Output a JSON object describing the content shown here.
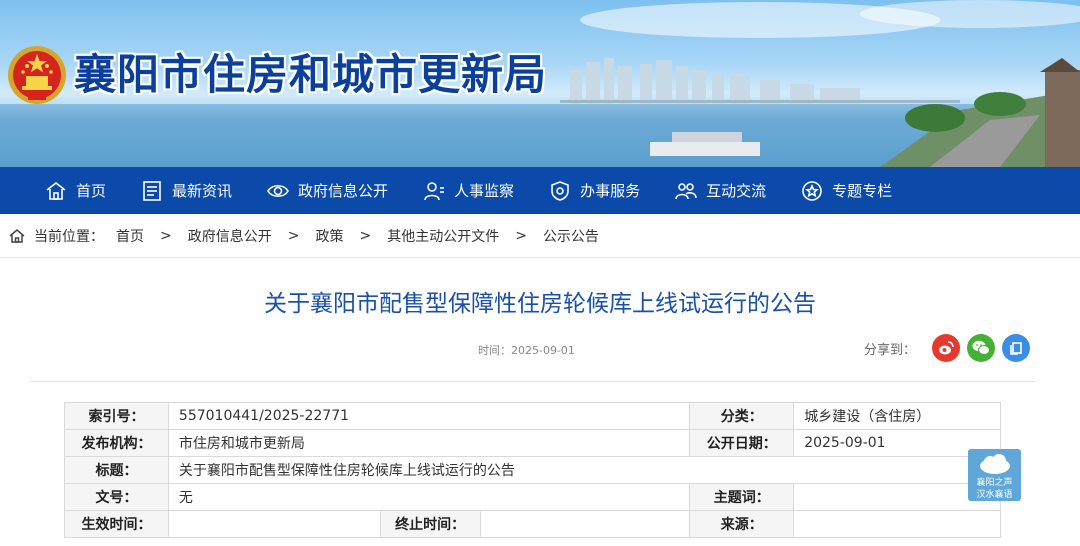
{
  "header": {
    "site_title": "襄阳市住房和城市更新局"
  },
  "nav": {
    "items": [
      {
        "label": "首页",
        "icon": "home-icon"
      },
      {
        "label": "最新资讯",
        "icon": "news-icon"
      },
      {
        "label": "政府信息公开",
        "icon": "eye-icon"
      },
      {
        "label": "人事监察",
        "icon": "person-icon"
      },
      {
        "label": "办事服务",
        "icon": "shield-icon"
      },
      {
        "label": "互动交流",
        "icon": "chat-icon"
      },
      {
        "label": "专题专栏",
        "icon": "star-icon"
      }
    ]
  },
  "breadcrumb": {
    "prefix": "当前位置：",
    "items": [
      "首页",
      "政府信息公开",
      "政策",
      "其他主动公开文件",
      "公示公告"
    ],
    "separator": ">"
  },
  "article": {
    "title": "关于襄阳市配售型保障性住房轮候库上线试运行的公告",
    "time": "时间：2025-09-01",
    "share_label": "分享到："
  },
  "info": {
    "index_key": "索引号：",
    "index_val": "557010441/2025-22771",
    "category_key": "分类：",
    "category_val": "城乡建设（含住房）",
    "publisher_key": "发布机构：",
    "publisher_val": "市住房和城市更新局",
    "date_key": "公开日期：",
    "date_val": "2025-09-01",
    "title_key": "标题：",
    "title_val": "关于襄阳市配售型保障性住房轮候库上线试运行的公告",
    "docno_key": "文号：",
    "docno_val": "无",
    "subject_key": "主题词：",
    "subject_val": "",
    "effective_key": "生效时间：",
    "effective_val": "",
    "expire_key": "终止时间：",
    "expire_val": "",
    "source_key": "来源：",
    "source_val": ""
  },
  "badge": {
    "line1": "襄阳之声",
    "line2": "汉水襄语"
  },
  "colors": {
    "nav_bg": "#0b4aa8",
    "title_blue": "#1a50a8",
    "weibo": "#e6392e",
    "wechat": "#45b035",
    "other": "#3a8ee6"
  }
}
